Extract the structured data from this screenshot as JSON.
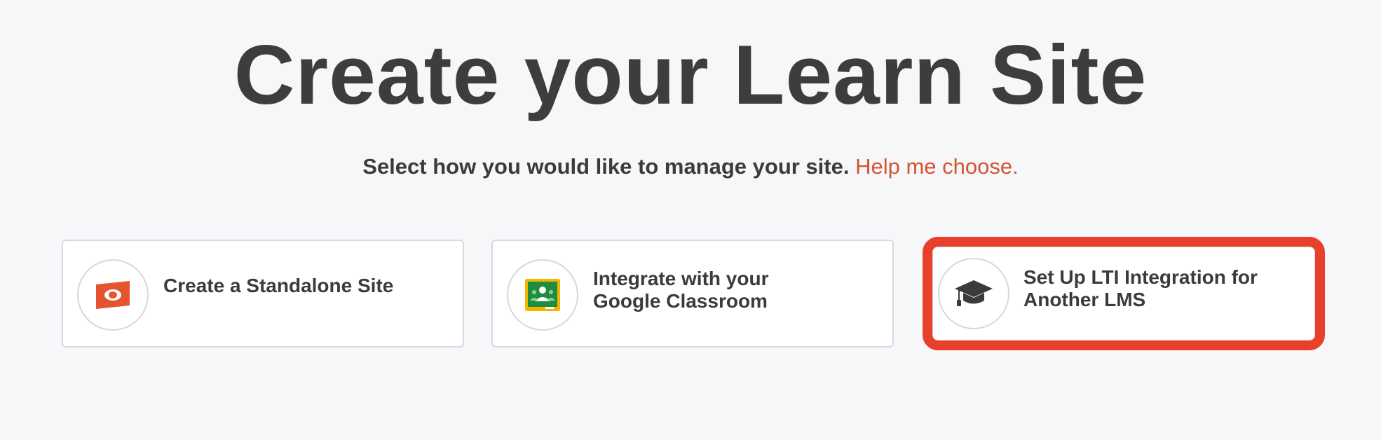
{
  "header": {
    "title": "Create your Learn Site"
  },
  "subtitle": {
    "text": "Select how you would like to manage your site.",
    "help_link": "Help me choose."
  },
  "options": [
    {
      "icon": "standalone-site-icon",
      "line1": "Create a Standalone Site",
      "line2": ""
    },
    {
      "icon": "google-classroom-icon",
      "line1": "Integrate with your",
      "line2": "Google Classroom"
    },
    {
      "icon": "graduation-cap-icon",
      "line1": "Set Up LTI Integration for",
      "line2": "Another LMS",
      "highlighted": true
    }
  ],
  "colors": {
    "accent": "#d5532f",
    "highlight": "#e8402a",
    "text": "#3b3b3b",
    "background": "#f6f7f9"
  }
}
